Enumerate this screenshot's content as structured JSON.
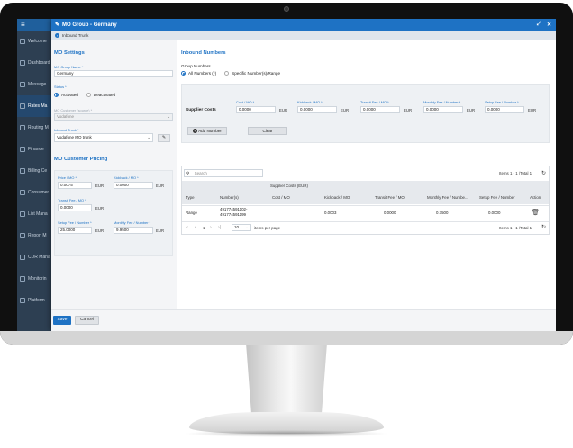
{
  "window": {
    "title": "MO Group - Germany",
    "breadcrumb": "Inbound Trunk"
  },
  "sidebar": {
    "items": [
      {
        "label": "Welcome",
        "icon": "home-icon"
      },
      {
        "label": "Dashboard",
        "icon": "dashboard-icon"
      },
      {
        "label": "Message",
        "icon": "message-icon"
      },
      {
        "label": "Rates Ma",
        "icon": "rates-icon"
      },
      {
        "label": "Routing M",
        "icon": "routing-icon"
      },
      {
        "label": "Finance",
        "icon": "finance-icon"
      },
      {
        "label": "Billing Ce",
        "icon": "billing-icon"
      },
      {
        "label": "Consumer",
        "icon": "consumer-icon"
      },
      {
        "label": "List Mana",
        "icon": "list-icon"
      },
      {
        "label": "Report M",
        "icon": "report-icon"
      },
      {
        "label": "CDR Mana",
        "icon": "cdr-icon"
      },
      {
        "label": "Monitorin",
        "icon": "monitor-icon"
      },
      {
        "label": "Platform",
        "icon": "platform-icon"
      }
    ]
  },
  "mo_settings": {
    "title": "MO Settings",
    "group_name_label": "MO Group Name *",
    "group_name_value": "Germany",
    "status_label": "Status *",
    "status_active": "Activated",
    "status_inactive": "Deactivated",
    "customer_label": "MO Customer (source) *",
    "customer_value": "Vodafone",
    "trunk_label": "Inbound Trunk *",
    "trunk_value": "Vodafone MO trunk"
  },
  "pricing": {
    "title": "MO Customer Pricing",
    "price_label": "Price / MO *",
    "price_value": "0.0075",
    "kickback_label": "Kickback / MO *",
    "kickback_value": "0.0000",
    "transit_label": "Transit Fee / MO *",
    "transit_value": "0.0000",
    "setup_label": "Setup Fee / Number *",
    "setup_value": "25.0000",
    "monthly_label": "Monthly Fee / Number *",
    "monthly_value": "9.9500",
    "currency": "EUR"
  },
  "inbound": {
    "title": "Inbound Numbers",
    "group_numbers_label": "Group Numbers",
    "opt_all": "All Numbers (*)",
    "opt_specific": "Specific Number(s)/Range",
    "supplier_costs_label": "Supplier Costs",
    "fields": [
      {
        "label": "Cost / MO *",
        "value": "0.0000"
      },
      {
        "label": "Kickback / MO *",
        "value": "0.0000"
      },
      {
        "label": "Transit Fee / MO *",
        "value": "0.0000"
      },
      {
        "label": "Monthly Fee / Number *",
        "value": "0.0000"
      },
      {
        "label": "Setup Fee / Number *",
        "value": "0.0000"
      }
    ],
    "currency": "EUR",
    "add_number": "Add Number",
    "clear": "Clear"
  },
  "grid": {
    "search_placeholder": "Search",
    "items_info": "Items 1 - 1 /Total 1",
    "group_header": "Supplier Costs (EUR)",
    "columns": [
      "Type",
      "Number(s)",
      "Cost / MO",
      "Kickback / MO",
      "Transit Fee / MO",
      "Monthly Fee / Numbe...",
      "Setup Fee / Number",
      "Action"
    ],
    "rows": [
      {
        "type": "Range",
        "numbers_1": "491774591102-",
        "numbers_2": "491774591199",
        "cost": "",
        "kickback": "0.0003",
        "transit": "0.0000",
        "monthly": "0.7500",
        "setup": "0.0000"
      }
    ],
    "pager_page": "1",
    "page_size": "10",
    "per_page_label": "items per page"
  },
  "footer": {
    "save": "Save",
    "cancel": "Cancel"
  }
}
